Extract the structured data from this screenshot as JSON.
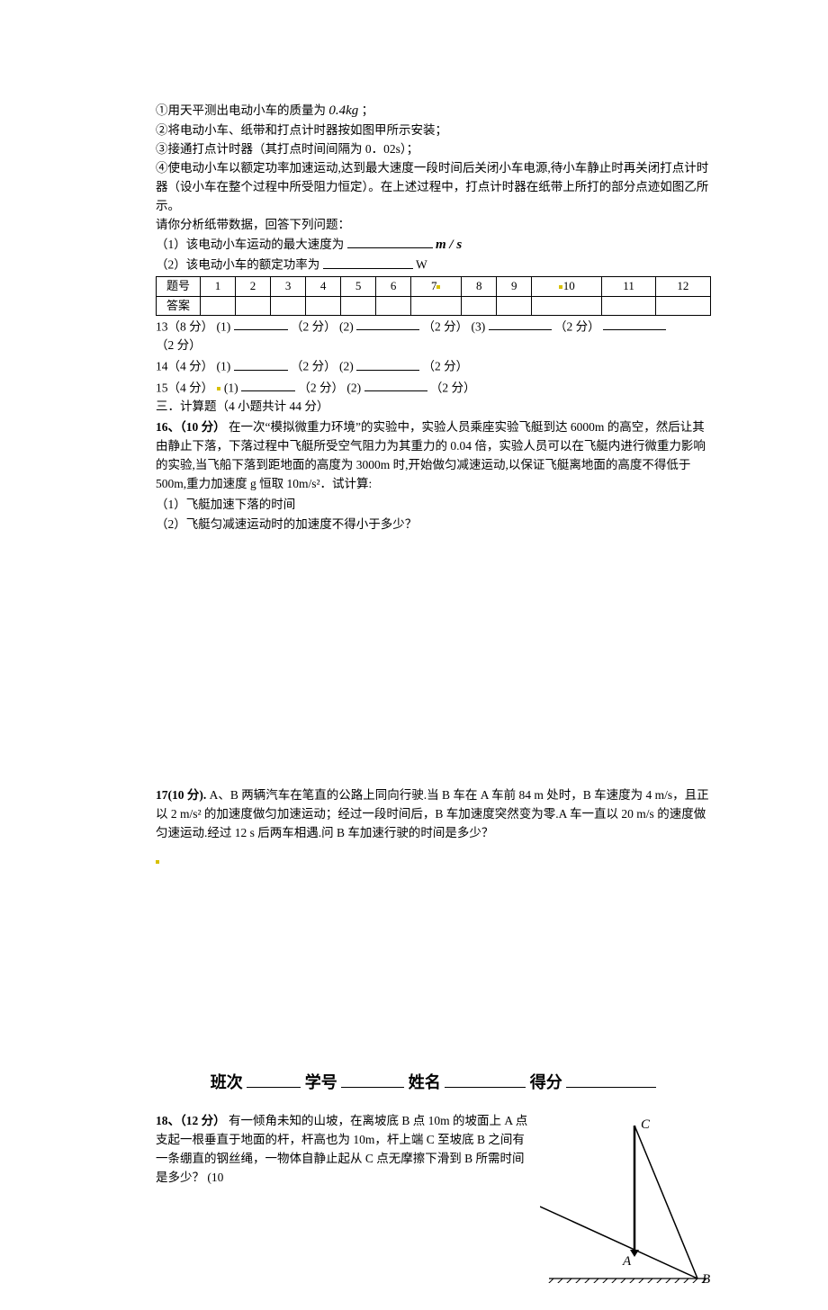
{
  "steps": {
    "s1a": "①用天平测出电动小车的质量为",
    "s1b": "0.4kg",
    "s1c": "；",
    "s2": "②将电动小车、纸带和打点计时器按如图甲所示安装；",
    "s3": "③接通打点计时器（其打点时间间隔为 0．02s）；",
    "s4": "④使电动小车以额定功率加速运动,达到最大速度一段时间后关闭小车电源,待小车静止时再关闭打点计时器（设小车在整个过程中所受阻力恒定）。在上述过程中，打点计时器在纸带上所打的部分点迹如图乙所示。",
    "s5": "请你分析纸带数据，回答下列问题：",
    "q1a": "（1）该电动小车运动的最大速度为",
    "q1b": "m / s",
    "q2a": "（2）该电动小车的额定功率为",
    "q2b": "W"
  },
  "table": {
    "row1_label": "题号",
    "cols": [
      "1",
      "2",
      "3",
      "4",
      "5",
      "6",
      "7",
      "8",
      "9",
      "10",
      "11",
      "12"
    ],
    "row2_label": "答案"
  },
  "lines": {
    "l13a": "13（8 分） (1)",
    "l13b": "（2 分）   (2)",
    "l13c": "（2 分）   (3)",
    "l13d": "（2 分）",
    "l13e": "（2 分）",
    "l14a": "14（4 分） (1)",
    "l14b": "（2 分）  (2)",
    "l14c": "（2 分）",
    "l15a": "15（4 分）",
    "l15b": "(1)",
    "l15c": "（2 分）  (2)",
    "l15d": "（2 分）"
  },
  "section3": "三．计算题（4 小题共计 44 分）",
  "q16": {
    "head": "16、（10 分）",
    "body": "在一次“模拟微重力环境”的实验中，实验人员乘座实验飞艇到达 6000m 的高空，然后让其由静止下落，下落过程中飞艇所受空气阻力为其重力的 0.04 倍，实验人员可以在飞艇内进行微重力影响的实验,当飞船下落到距地面的高度为 3000m 时,开始做匀减速运动,以保证飞艇离地面的高度不得低于 500m,重力加速度 g 恒取 10m/s²．试计算:",
    "sub1": "（1）飞艇加速下落的时间",
    "sub2": "（2）飞艇匀减速运动时的加速度不得小于多少？"
  },
  "q17": {
    "head": "17(10 分).",
    "body": "A、B 两辆汽车在笔直的公路上同向行驶.当 B 车在 A 车前 84 m 处时，B 车速度为 4 m/s，且正以 2 m/s² 的加速度做匀加速运动；经过一段时间后，B 车加速度突然变为零.A 车一直以 20 m/s 的速度做匀速运动.经过 12 s 后两车相遇.问 B 车加速行驶的时间是多少？"
  },
  "footer": {
    "class_label": "班次",
    "id_label": "学号",
    "name_label": "姓名",
    "score_label": "得分"
  },
  "q18": {
    "head": "18、（12 分）",
    "body": "有一倾角未知的山坡，在离坡底 B 点 10m 的坡面上 A 点支起一根垂直于地面的杆，杆高也为 10m，杆上端 C 至坡底 B 之间有一条绷直的钢丝绳，一物体自静止起从 C 点无摩擦下滑到 B 所需时间是多少？  (10",
    "labelA": "A",
    "labelB": "B",
    "labelC": "C"
  }
}
